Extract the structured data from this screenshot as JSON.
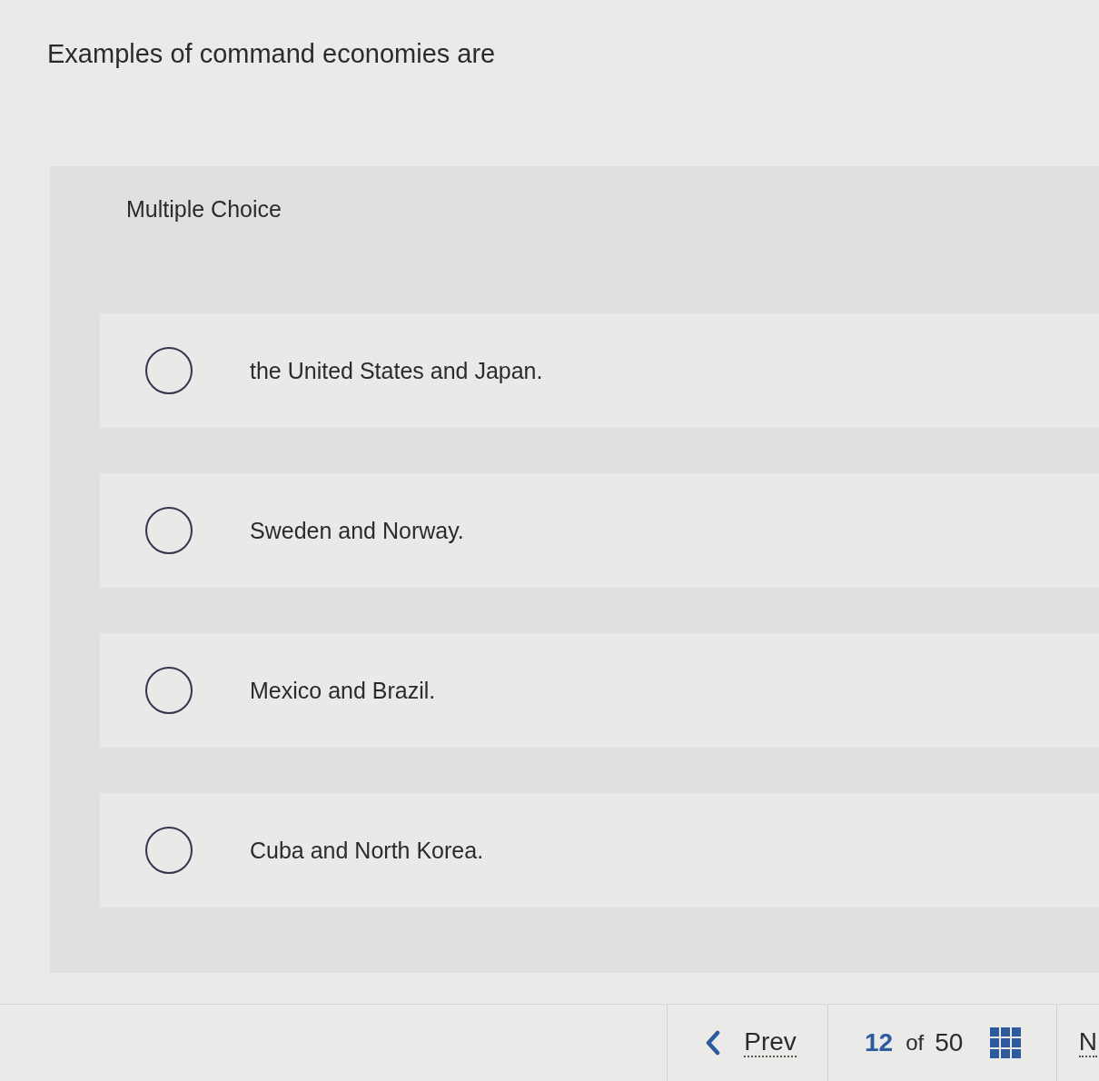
{
  "question": {
    "text": "Examples of command economies are"
  },
  "question_type": "Multiple Choice",
  "options": [
    {
      "label": "the United States and Japan.",
      "selected": false
    },
    {
      "label": "Sweden and Norway.",
      "selected": false
    },
    {
      "label": "Mexico and Brazil.",
      "selected": false
    },
    {
      "label": "Cuba and North Korea.",
      "selected": false
    }
  ],
  "navigation": {
    "prev": {
      "label": "Prev"
    },
    "position": {
      "current": "12",
      "separator": "of",
      "total": "50"
    },
    "next": {
      "label": "N"
    }
  }
}
